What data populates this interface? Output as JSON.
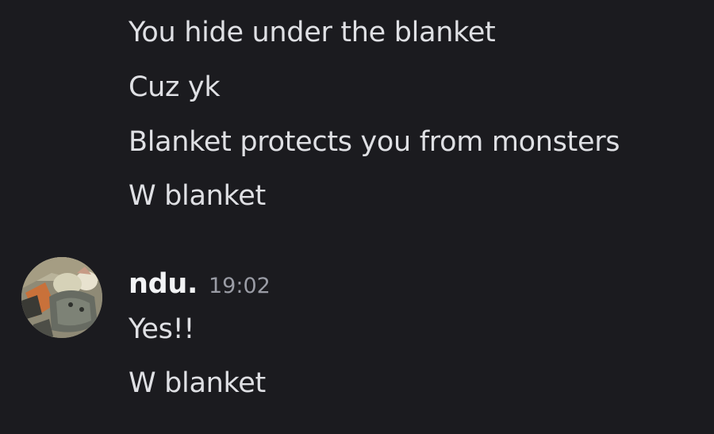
{
  "previous_messages": [
    "You hide under the blanket",
    "Cuz yk",
    "Blanket protects you from monsters",
    "W blanket"
  ],
  "message_group": {
    "username": "ndu.",
    "timestamp": "19:02",
    "avatar": "avatar-image",
    "messages": [
      "Yes!!",
      "W blanket"
    ]
  }
}
